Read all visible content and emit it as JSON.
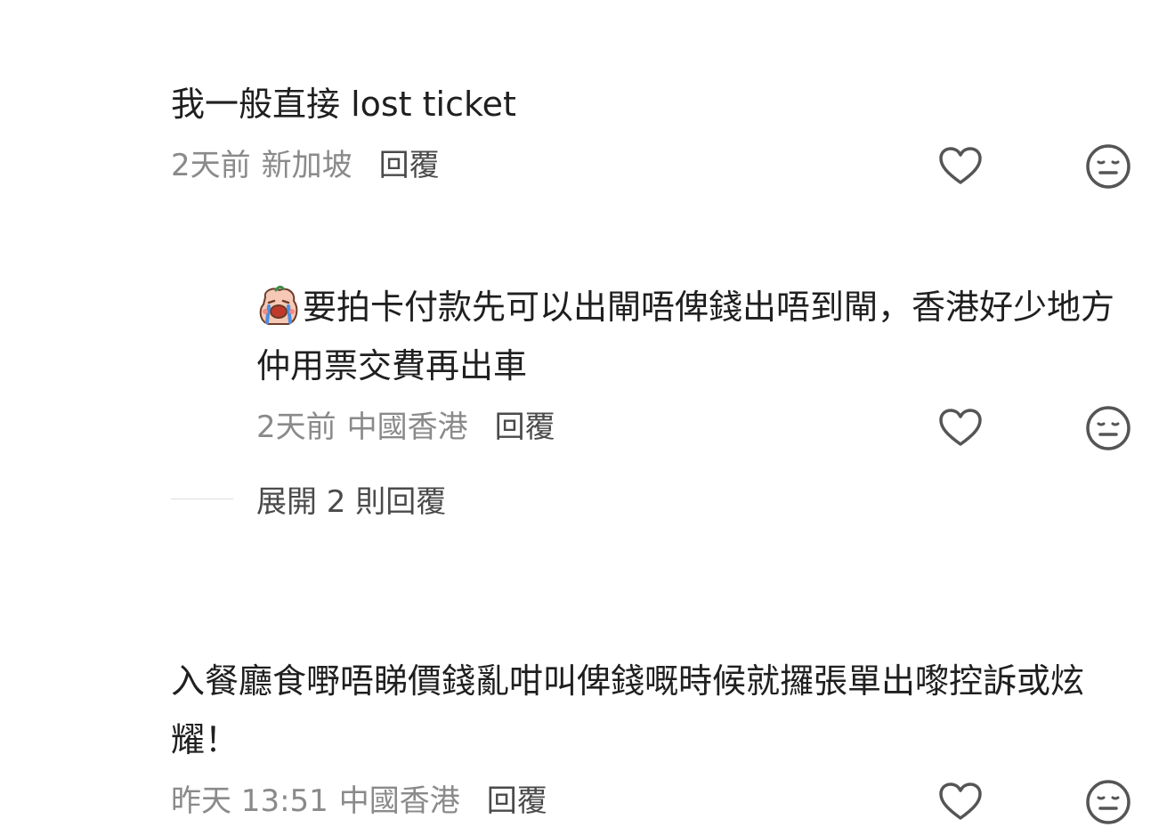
{
  "comments": [
    {
      "text": "我一般直接 lost ticket",
      "time": "2天前",
      "location": "新加坡",
      "reply_label": "回覆"
    },
    {
      "emoji": "crying-face-emoji",
      "text": "要拍卡付款先可以出閘唔俾錢出唔到閘，香港好少地方仲用票交費再出車",
      "time": "2天前",
      "location": "中國香港",
      "reply_label": "回覆"
    },
    {
      "text": "入餐廳食嘢唔睇價錢亂咁叫俾錢嘅時候就攞張單出嚟控訴或炫耀！",
      "time": "昨天 13:51",
      "location": "中國香港",
      "reply_label": "回覆"
    }
  ],
  "expand_replies_label": "展開 2 則回覆",
  "icons": {
    "like": "heart-icon",
    "dislike": "neutral-face-icon"
  },
  "colors": {
    "text": "#1f1f1f",
    "meta": "#8a8a8a",
    "reply": "#4a4a4a",
    "icon": "#555555"
  }
}
